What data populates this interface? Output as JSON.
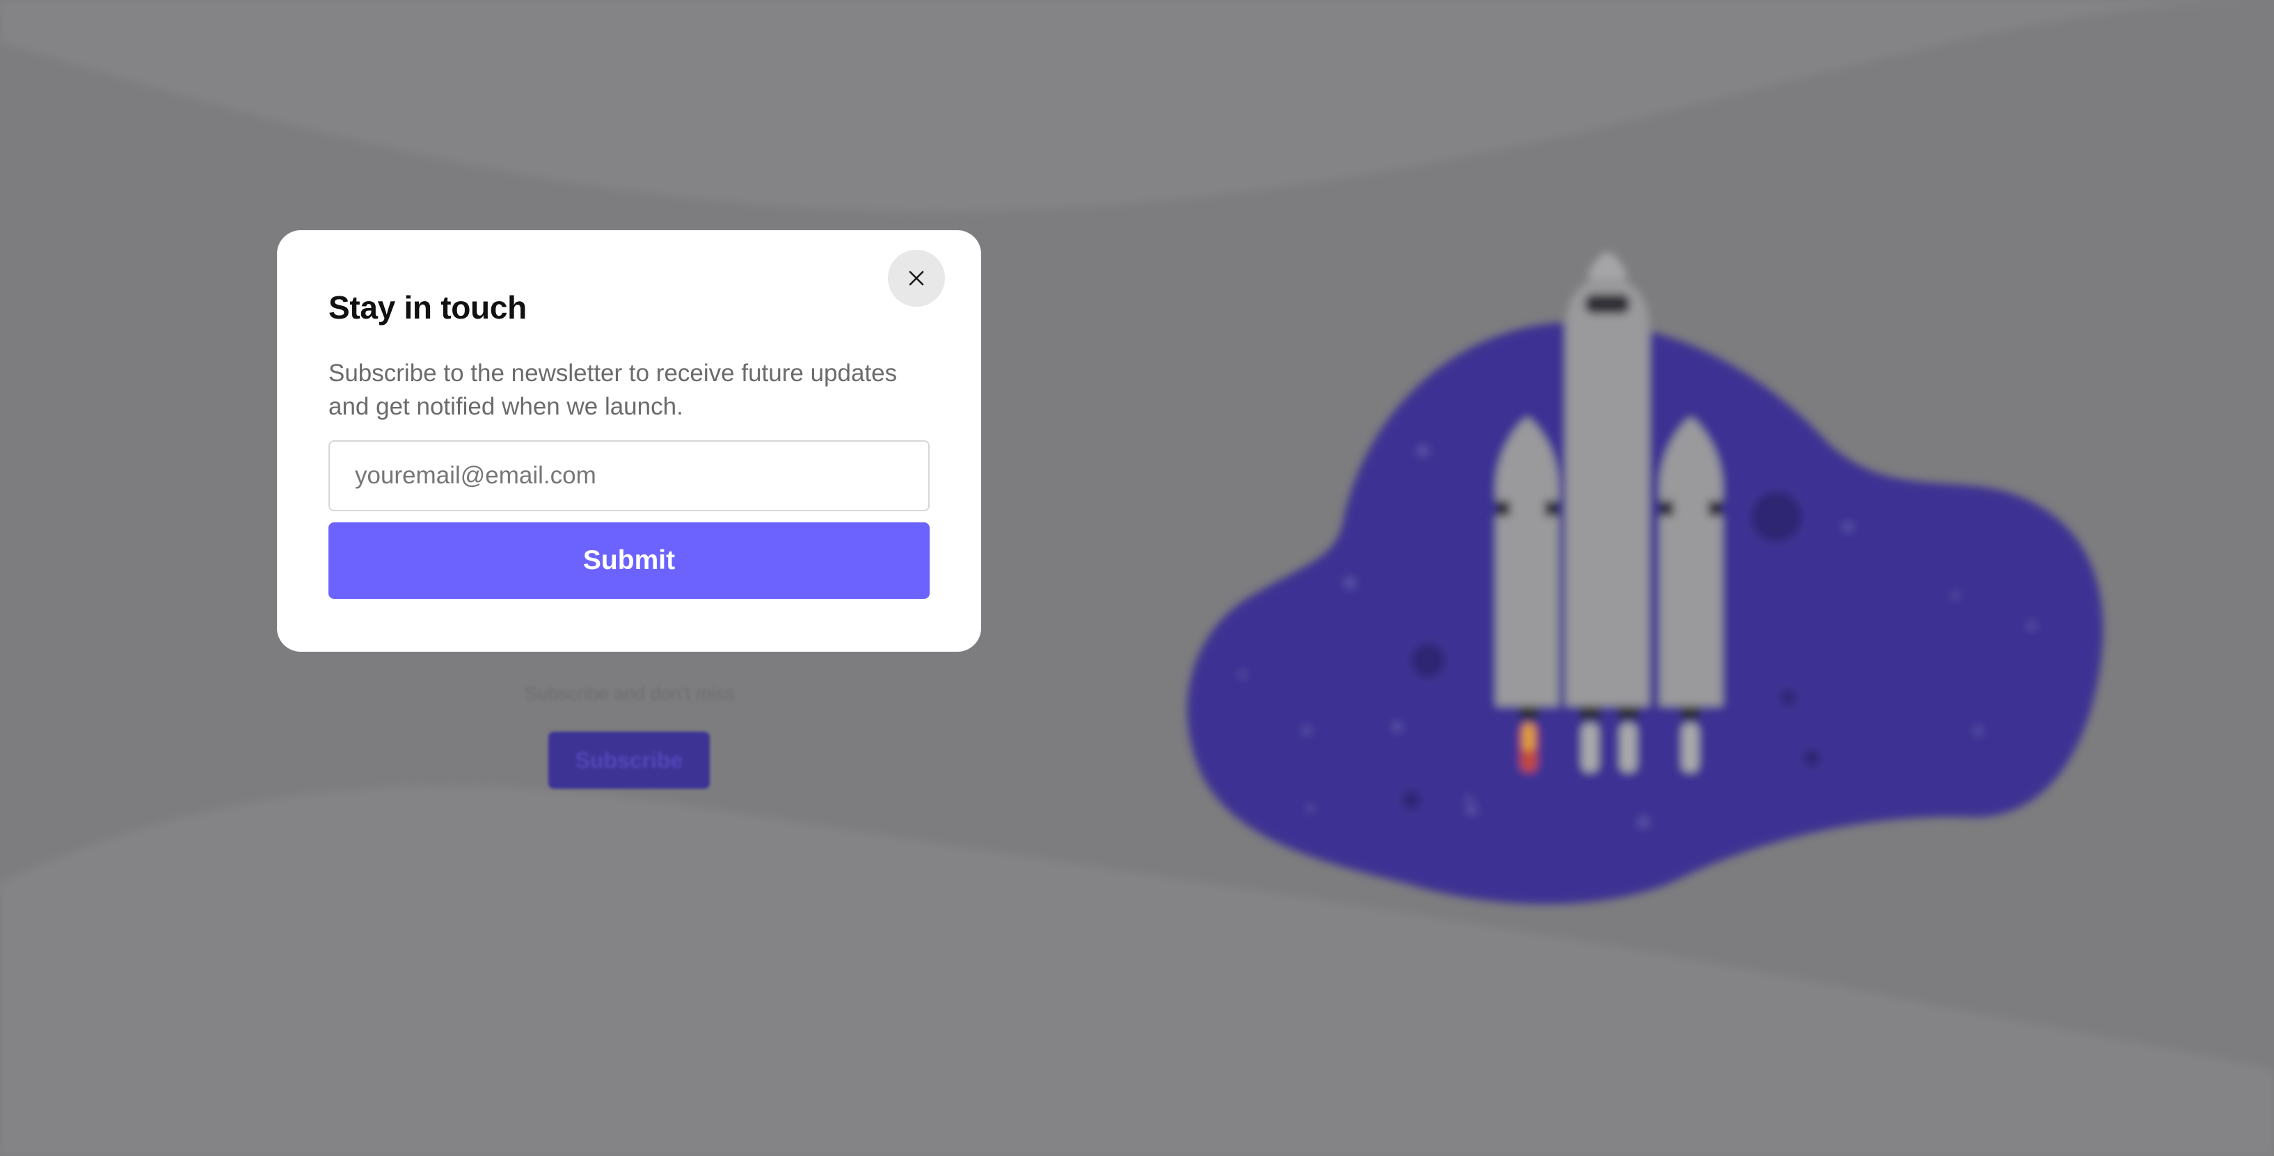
{
  "background": {
    "subtitle": "Subscribe and don't miss",
    "subscribe_label": "Subscribe",
    "illustration": "rocket-launch-illustration"
  },
  "modal": {
    "title": "Stay in touch",
    "description": "Subscribe to the newsletter to receive future updates and get notified when we launch.",
    "email_placeholder": "youremail@email.com",
    "email_value": "",
    "submit_label": "Submit",
    "close_icon": "close-icon"
  },
  "colors": {
    "overlay": "#7d7d7f",
    "accent": "#6c63ff",
    "blob": "#3d3393",
    "modal_bg": "#ffffff"
  }
}
